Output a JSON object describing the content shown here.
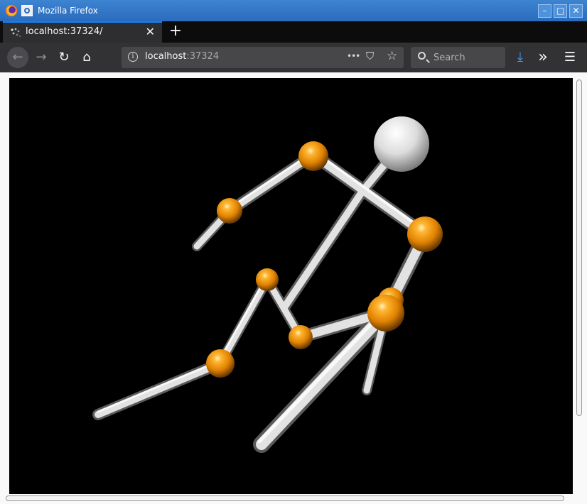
{
  "window": {
    "title": "Mozilla Firefox",
    "controls": {
      "minimize": "–",
      "maximize": "□",
      "close": "✕"
    }
  },
  "tabs": [
    {
      "label": "localhost:37324/",
      "close": "✕"
    }
  ],
  "tabbar": {
    "new_tab": "+"
  },
  "navbar": {
    "back": "←",
    "forward": "→",
    "reload": "↻",
    "home": "⌂",
    "url_host": "localhost",
    "url_port": ":37324",
    "page_actions": "•••",
    "pocket": "⛉",
    "bookmark": "☆",
    "search_placeholder": "Search",
    "download": "⤓",
    "overflow": "»",
    "menu": "☰"
  },
  "colors": {
    "atom_orange": "#e88a00",
    "atom_white": "#ededed",
    "bond": "#d0d0d0",
    "background": "#000000"
  }
}
